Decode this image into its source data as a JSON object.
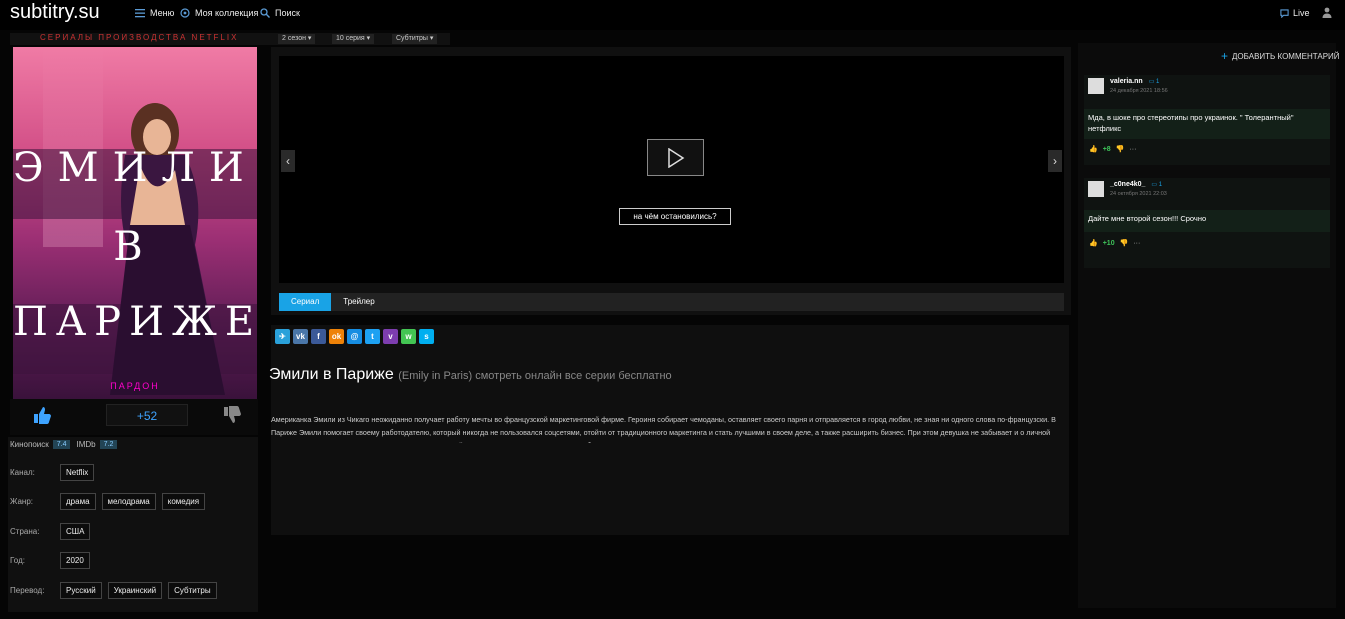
{
  "header": {
    "logo": "subtitry.su",
    "nav": [
      {
        "label": "Меню",
        "icon": "menu-icon"
      },
      {
        "label": "Моя коллекция",
        "icon": "collection-icon"
      },
      {
        "label": "Поиск",
        "icon": "search-icon"
      }
    ],
    "live_label": "Live"
  },
  "subbar": {
    "breadcrumb": "СЕРИАЛЫ ПРОИЗВОДСТВА NETFLIX",
    "season": "2 сезон",
    "episode": "10 серия",
    "translation": "Субтитры"
  },
  "poster": {
    "title_line1": "ЭМИЛИ",
    "title_line2": "В",
    "title_line3": "ПАРИЖЕ",
    "small_text": "ПАРДОН"
  },
  "rating": {
    "score": "+52"
  },
  "info": {
    "ratings_label": "Кинопоиск",
    "kp_value": "7.4",
    "imdb_label": "IMDb",
    "imdb_value": "7.2",
    "channel_label": "Канал:",
    "channel": "Netflix",
    "genre_label": "Жанр:",
    "genres": [
      "драма",
      "мелодрама",
      "комедия"
    ],
    "country_label": "Страна:",
    "country": "США",
    "year_label": "Год:",
    "year": "2020",
    "translation_label": "Перевод:",
    "translations": [
      "Русский",
      "Украинский",
      "Субтитры"
    ]
  },
  "player": {
    "resume_label": "на чём остановились?",
    "tabs": [
      "Сериал",
      "Трейлер"
    ],
    "active_tab": 0
  },
  "shares": [
    {
      "icon": "telegram-icon",
      "color": "#2aa1da",
      "glyph": "✈"
    },
    {
      "icon": "vk-icon",
      "color": "#4a76a8",
      "glyph": "vk"
    },
    {
      "icon": "facebook-icon",
      "color": "#3b5998",
      "glyph": "f"
    },
    {
      "icon": "odnoklassniki-icon",
      "color": "#ee8208",
      "glyph": "ok"
    },
    {
      "icon": "moimir-icon",
      "color": "#168de2",
      "glyph": "@"
    },
    {
      "icon": "twitter-icon",
      "color": "#1da1f2",
      "glyph": "t"
    },
    {
      "icon": "viber-icon",
      "color": "#7d3daf",
      "glyph": "v"
    },
    {
      "icon": "whatsapp-icon",
      "color": "#43c553",
      "glyph": "w"
    },
    {
      "icon": "skype-icon",
      "color": "#00aff0",
      "glyph": "s"
    }
  ],
  "description": {
    "title": "Эмили в Париже",
    "original": "(Emily in Paris) смотреть онлайн все серии бесплатно",
    "text": "Американка Эмили из Чикаго неожиданно получает работу мечты во французской маркетинговой фирме. Героиня собирает чемоданы, оставляет своего парня и отправляется в город любви, не зная ни одного слова по-французски. В Париже Эмили помогает своему работодателю, который никогда не пользовался соцсетями, отойти от традиционного маркетинга и стать лучшими в своем деле, а также расширить бизнес. При этом девушка не забывает и о личной жизни, погружаясь в череду увлекательных приключений о новыми коллегами, друзьями и любовниками..."
  },
  "comments": {
    "add_label": "ДОБАВИТЬ КОММЕНТАРИЙ",
    "items": [
      {
        "user": "valeria.nn",
        "replies": "1",
        "date": "24 декабря 2021 18:56",
        "text": "Мда, в шоке про стереотипы про украинок. \" Толерантный\" нетфликс",
        "votes": "+8"
      },
      {
        "user": "_c0ne4k0_",
        "replies": "1",
        "date": "24 октября 2021 22:03",
        "text": "Дайте мне второй сезон!!! Срочно",
        "votes": "+10"
      }
    ]
  }
}
